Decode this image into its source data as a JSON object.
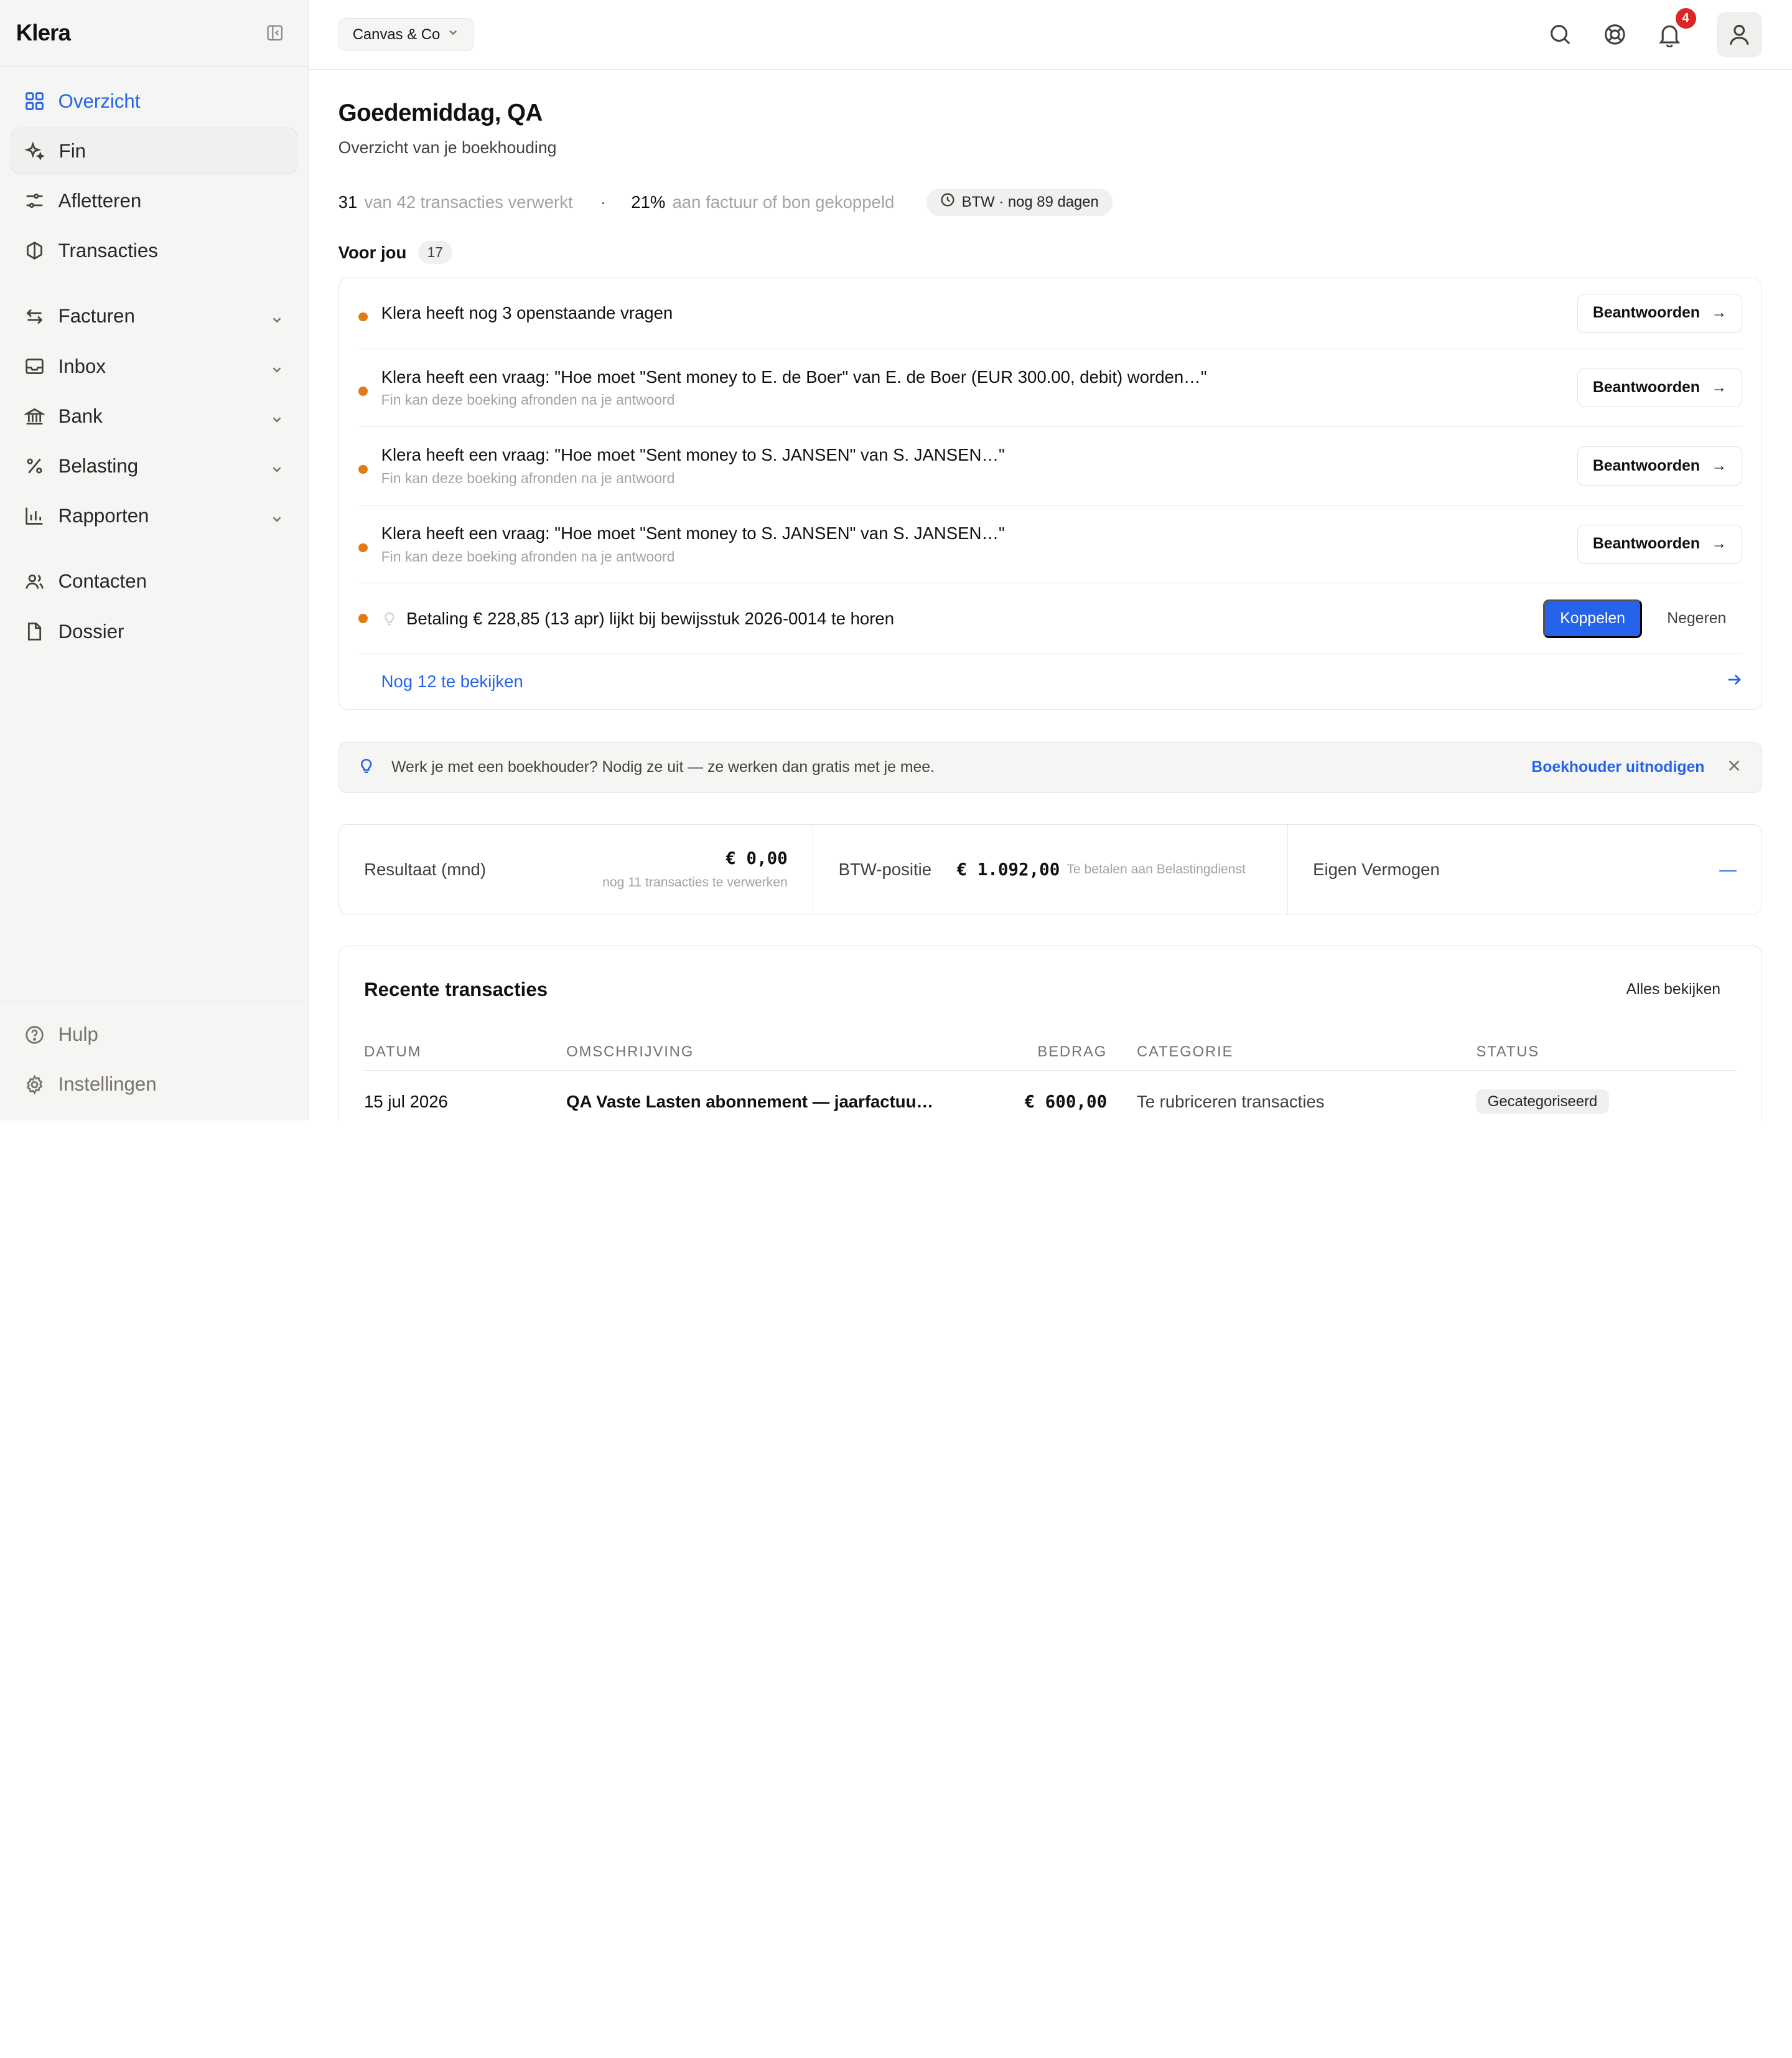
{
  "app": {
    "name": "Klera"
  },
  "sidebar": {
    "items": [
      {
        "label": "Overzicht",
        "icon": "grid-icon"
      },
      {
        "label": "Fin",
        "icon": "sparkle-icon"
      },
      {
        "label": "Afletteren",
        "icon": "sliders-icon"
      },
      {
        "label": "Transacties",
        "icon": "hexagon-icon"
      },
      {
        "label": "Facturen",
        "icon": "arrows-icon"
      },
      {
        "label": "Inbox",
        "icon": "inbox-icon"
      },
      {
        "label": "Bank",
        "icon": "bank-icon"
      },
      {
        "label": "Belasting",
        "icon": "percent-icon"
      },
      {
        "label": "Rapporten",
        "icon": "bar-chart-icon"
      },
      {
        "label": "Contacten",
        "icon": "users-icon"
      },
      {
        "label": "Dossier",
        "icon": "file-icon"
      }
    ],
    "footer": [
      {
        "label": "Hulp",
        "icon": "help-icon"
      },
      {
        "label": "Instellingen",
        "icon": "gear-icon"
      }
    ]
  },
  "topbar": {
    "company": "Canvas & Co",
    "notifications": "4"
  },
  "header": {
    "greeting": "Goedemiddag, QA",
    "subtitle": "Overzicht van je boekhouding"
  },
  "stats": {
    "processed": "31",
    "processed_text": "van 42 transacties verwerkt",
    "separator": "·",
    "linked": "21%",
    "linked_text": "aan factuur of bon gekoppeld",
    "btw": "BTW · nog 89 dagen"
  },
  "for_you": {
    "title": "Voor jou",
    "count": "17",
    "tasks": [
      {
        "text": "Klera heeft nog 3 openstaande vragen",
        "sub": "",
        "action": "Beantwoorden"
      },
      {
        "text": "Klera heeft een vraag: \"Hoe moet \"Sent money to E. de Boer\" van E. de Boer (EUR 300.00, debit) worden…\"",
        "sub": "Fin kan deze boeking afronden na je antwoord",
        "action": "Beantwoorden"
      },
      {
        "text": "Klera heeft een vraag: \"Hoe moet \"Sent money to S. JANSEN\" van S. JANSEN…\"",
        "sub": "Fin kan deze boeking afronden na je antwoord",
        "action": "Beantwoorden"
      },
      {
        "text": "Klera heeft een vraag: \"Hoe moet \"Sent money to S. JANSEN\" van S. JANSEN…\"",
        "sub": "Fin kan deze boeking afronden na je antwoord",
        "action": "Beantwoorden"
      }
    ],
    "match": {
      "text": "Betaling € 228,85 (13 apr) lijkt bij bewijsstuk 2026-0014 te horen",
      "primary": "Koppelen",
      "secondary": "Negeren"
    },
    "more": "Nog 12 te bekijken"
  },
  "tip": {
    "text": "Werk je met een boekhouder? Nodig ze uit — ze werken dan gratis met je mee.",
    "link": "Boekhouder uitnodigen"
  },
  "kpis": {
    "result_label": "Resultaat (mnd)",
    "result_value": "€ 0,00",
    "result_note": "nog 11 transacties te verwerken",
    "btw_label": "BTW-positie",
    "btw_value": "€ 1.092,00",
    "btw_note": "Te betalen aan Belastingdienst",
    "equity_label": "Eigen Vermogen",
    "equity_value": "—"
  },
  "recent": {
    "title": "Recente transacties",
    "link": "Alles bekijken",
    "columns": [
      "DATUM",
      "OMSCHRIJVING",
      "BEDRAG",
      "CATEGORIE",
      "STATUS"
    ],
    "rows": [
      [
        "15 jul 2026",
        "QA Vaste Lasten abonnement — jaarfactuu…",
        "€ 600,00",
        "Te rubriceren transacties",
        "Gecategoriseerd"
      ]
    ]
  },
  "colors": {
    "accent": "#2563eb",
    "task_dot": "#e07b1a",
    "badge": "#dc2626"
  }
}
